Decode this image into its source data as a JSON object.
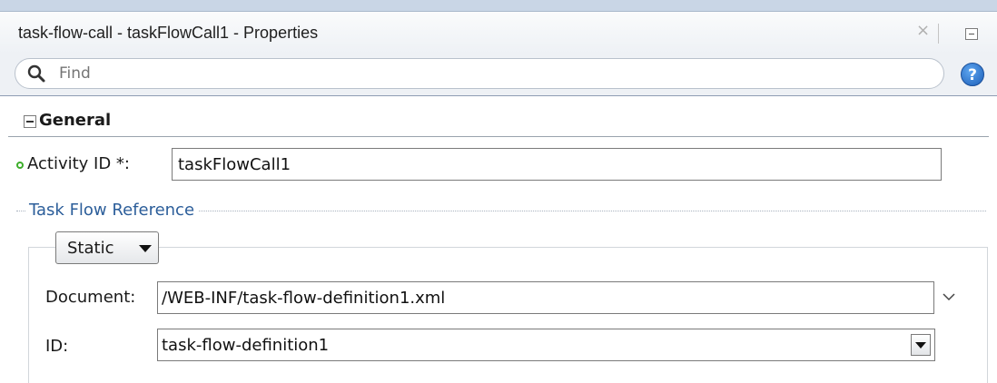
{
  "panel": {
    "title": "task-flow-call - taskFlowCall1 - Properties",
    "close_icon": "close-icon",
    "minimize_icon": "minimize-icon"
  },
  "search": {
    "placeholder": "Find",
    "icon": "search-icon",
    "help_label": "?"
  },
  "general": {
    "label": "General",
    "collapse_icon": "collapse-icon"
  },
  "activity": {
    "label": "Activity ID *:",
    "value": "taskFlowCall1",
    "required_indicator_color": "#3dae2b"
  },
  "task_flow_reference": {
    "label": "Task Flow Reference",
    "mode": "Static",
    "document_label": "Document:",
    "document_value": "/WEB-INF/task-flow-definition1.xml",
    "id_label": "ID:",
    "id_value": "task-flow-definition1"
  }
}
